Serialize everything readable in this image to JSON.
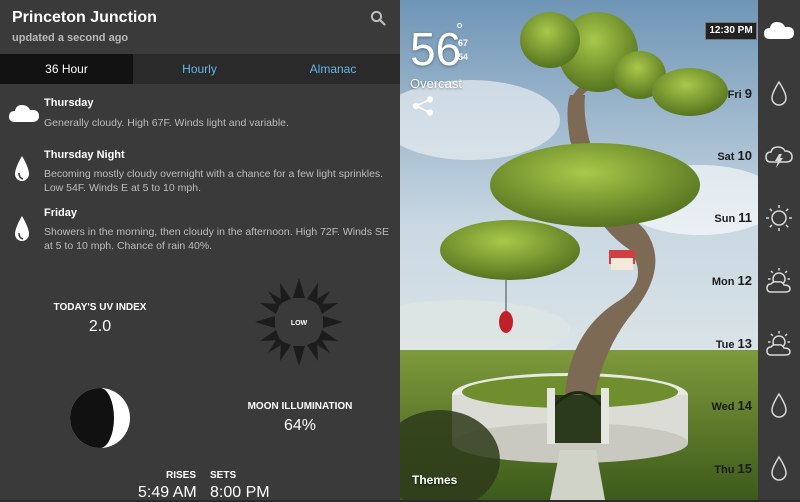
{
  "header": {
    "city": "Princeton Junction",
    "updated": "updated a second ago",
    "search_icon": "search-icon"
  },
  "tabs": [
    {
      "label": "36 Hour",
      "active": true
    },
    {
      "label": "Hourly",
      "active": false
    },
    {
      "label": "Almanac",
      "active": false
    }
  ],
  "forecast": [
    {
      "title": "Thursday",
      "text": "Generally cloudy. High 67F. Winds light and variable.",
      "icon": "cloud-icon"
    },
    {
      "title": "Thursday Night",
      "text": "Becoming mostly cloudy overnight with a chance for a few light sprinkles. Low 54F. Winds E at 5 to 10 mph.",
      "icon": "raindrop-icon"
    },
    {
      "title": "Friday",
      "text": "Showers in the morning, then cloudy in the afternoon. High 72F. Winds SE at 5 to 10 mph. Chance of rain 40%.",
      "icon": "raindrop-icon"
    }
  ],
  "uv": {
    "label": "TODAY'S UV INDEX",
    "value": "2.0",
    "badge": "LOW"
  },
  "moon": {
    "label": "MOON ILLUMINATION",
    "value": "64%"
  },
  "sun": {
    "rises_label": "RISES",
    "rises_value": "5:49 AM",
    "sets_label": "SETS",
    "sets_value": "8:00 PM"
  },
  "current": {
    "temp": "56",
    "degree": "°",
    "high": "67",
    "low": "54",
    "condition": "Overcast",
    "time": "12:30 PM",
    "themes_label": "Themes"
  },
  "days": [
    {
      "name": "Fri",
      "num": "9",
      "icon": "raindrop-icon"
    },
    {
      "name": "Sat",
      "num": "10",
      "icon": "thunder-cloud-icon"
    },
    {
      "name": "Sun",
      "num": "11",
      "icon": "sun-icon"
    },
    {
      "name": "Mon",
      "num": "12",
      "icon": "partly-cloudy-icon"
    },
    {
      "name": "Tue",
      "num": "13",
      "icon": "partly-cloudy-icon"
    },
    {
      "name": "Wed",
      "num": "14",
      "icon": "raindrop-icon"
    },
    {
      "name": "Thu",
      "num": "15",
      "icon": "raindrop-icon"
    }
  ],
  "colors": {
    "accent": "#5fb8e6",
    "panel": "#3a3a3a",
    "tab_active": "#121212"
  }
}
